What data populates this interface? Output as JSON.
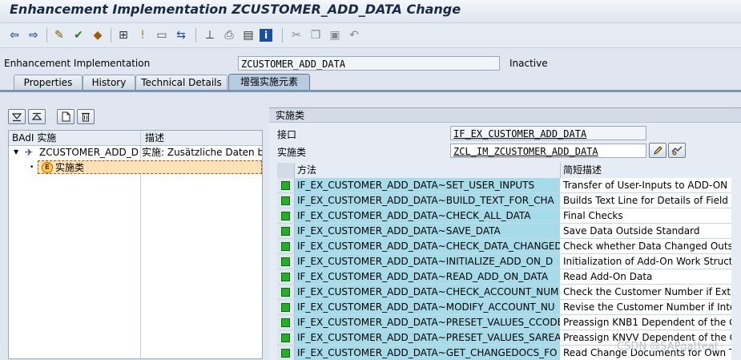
{
  "window": {
    "title": "Enhancement Implementation ZCUSTOMER_ADD_DATA Change"
  },
  "header": {
    "label": "Enhancement Implementation",
    "value": "ZCUSTOMER_ADD_DATA",
    "status": "Inactive"
  },
  "tabs": [
    {
      "label": "Properties"
    },
    {
      "label": "History"
    },
    {
      "label": "Technical Details"
    },
    {
      "label": "增强实施元素"
    }
  ],
  "tree": {
    "columns": [
      "BAdI 实施",
      "描述"
    ],
    "rows": [
      {
        "name": "ZCUSTOMER_ADD_DA",
        "desc": "实施:  Zusätzliche Daten be"
      },
      {
        "name": "实施类",
        "desc": ""
      }
    ]
  },
  "impl": {
    "section_title": "实施类",
    "interface_label": "接口",
    "interface_value": "IF_EX_CUSTOMER_ADD_DATA",
    "class_label": "实施类",
    "class_value": "ZCL_IM_ZCUSTOMER_ADD_DATA"
  },
  "methods": {
    "columns": [
      "方法",
      "简短描述"
    ],
    "rows": [
      {
        "method": "IF_EX_CUSTOMER_ADD_DATA~SET_USER_INPUTS",
        "desc": "Transfer of User-Inputs to ADD-ON"
      },
      {
        "method": "IF_EX_CUSTOMER_ADD_DATA~BUILD_TEXT_FOR_CHA",
        "desc": "Builds Text Line for Details of Field C"
      },
      {
        "method": "IF_EX_CUSTOMER_ADD_DATA~CHECK_ALL_DATA",
        "desc": "Final Checks"
      },
      {
        "method": "IF_EX_CUSTOMER_ADD_DATA~SAVE_DATA",
        "desc": "Save Data Outside Standard"
      },
      {
        "method": "IF_EX_CUSTOMER_ADD_DATA~CHECK_DATA_CHANGED",
        "desc": "Check whether Data Changed Outsi"
      },
      {
        "method": "IF_EX_CUSTOMER_ADD_DATA~INITIALIZE_ADD_ON_D",
        "desc": "Initialization of Add-On Work Structu"
      },
      {
        "method": "IF_EX_CUSTOMER_ADD_DATA~READ_ADD_ON_DATA",
        "desc": "Read Add-On Data"
      },
      {
        "method": "IF_EX_CUSTOMER_ADD_DATA~CHECK_ACCOUNT_NUM",
        "desc": "Check the Customer Number if Exter"
      },
      {
        "method": "IF_EX_CUSTOMER_ADD_DATA~MODIFY_ACCOUNT_NU",
        "desc": "Revise the Customer Number if Inter"
      },
      {
        "method": "IF_EX_CUSTOMER_ADD_DATA~PRESET_VALUES_CCODE",
        "desc": "Preassign KNB1 Dependent of the G"
      },
      {
        "method": "IF_EX_CUSTOMER_ADD_DATA~PRESET_VALUES_SAREA",
        "desc": "Preassign KNVV Dependent of the G"
      },
      {
        "method": "IF_EX_CUSTOMER_ADD_DATA~GET_CHANGEDOCS_FO",
        "desc": "Read Change Documents for Own T"
      }
    ]
  },
  "watermark": "CSDN @SAPgatteat"
}
